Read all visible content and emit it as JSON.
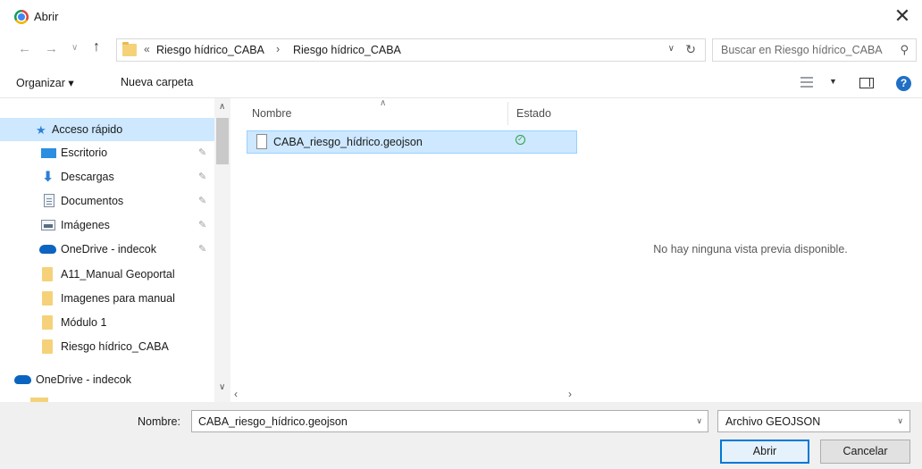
{
  "window": {
    "title": "Abrir",
    "close_symbol": "✕"
  },
  "address": {
    "crumbs_prefix": "«",
    "crumbs": [
      "Riesgo hídrico_CABA",
      "Riesgo hídrico_CABA"
    ],
    "separator": "›",
    "search_placeholder": "Buscar en Riesgo hídrico_CABA"
  },
  "toolbar": {
    "organize_label": "Organizar ▾",
    "new_folder_label": "Nueva carpeta"
  },
  "sidebar": {
    "items": [
      {
        "label": "Acceso rápido",
        "icon": "star-icon",
        "pinned": false
      },
      {
        "label": "Escritorio",
        "icon": "desktop-icon",
        "pinned": true
      },
      {
        "label": "Descargas",
        "icon": "download-icon",
        "pinned": true
      },
      {
        "label": "Documentos",
        "icon": "document-icon",
        "pinned": true
      },
      {
        "label": "Imágenes",
        "icon": "image-icon",
        "pinned": true
      },
      {
        "label": "OneDrive - indecok",
        "icon": "cloud-icon",
        "pinned": true
      },
      {
        "label": "A11_Manual Geoportal",
        "icon": "folder-icon",
        "pinned": false
      },
      {
        "label": "Imagenes para manual",
        "icon": "folder-icon",
        "pinned": false
      },
      {
        "label": "Módulo 1",
        "icon": "folder-icon",
        "pinned": false
      },
      {
        "label": "Riesgo hídrico_CABA",
        "icon": "folder-icon",
        "pinned": false
      },
      {
        "label": "OneDrive - indecok",
        "icon": "cloud-icon",
        "pinned": false
      }
    ]
  },
  "filelist": {
    "columns": [
      "Nombre",
      "Estado"
    ],
    "files": [
      {
        "name": "CABA_riesgo_hídrico.geojson",
        "status": "synced"
      }
    ]
  },
  "preview": {
    "empty_text": "No hay ninguna vista previa disponible."
  },
  "footer": {
    "filename_label": "Nombre:",
    "filename_value": "CABA_riesgo_hídrico.geojson",
    "filetype_value": "Archivo GEOJSON",
    "open_label": "Abrir",
    "cancel_label": "Cancelar"
  },
  "colors": {
    "selection": "#cde8ff",
    "accent": "#0078d7",
    "folder": "#f5d27a"
  }
}
